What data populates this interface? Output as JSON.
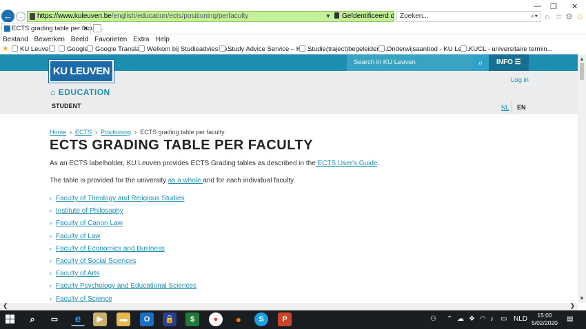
{
  "browser": {
    "url_host": "https://www.kuleuven.be",
    "url_path": "/english/education/ects/positioning/perfaculty",
    "cert_label": "Geïdentificeerd door DigiCert",
    "search_placeholder": "Zoeken...",
    "tab_title": "ECTS grading table per facult...",
    "menu": [
      "Bestand",
      "Bewerken",
      "Beeld",
      "Favorieten",
      "Extra",
      "Help"
    ],
    "favorites": [
      "KU Leuven",
      "Google",
      "Google Translate",
      "Welkom bij Studieadvies Le...",
      "Study Advice Service – KU ...",
      "Studie(traject)begeleiders i...",
      "Onderwijsaanbod - KU Leu...",
      "KUCL - universitaire termin..."
    ]
  },
  "site": {
    "logo": "KU LEUVEN",
    "search_placeholder": "Search in KU Leuven",
    "info_label": "INFO",
    "section": "EDUCATION",
    "audience": "STUDENT",
    "login": "Log in",
    "lang_nl": "NL",
    "lang_en": "EN"
  },
  "breadcrumb": {
    "home": "Home",
    "ects": "ECTS",
    "positioning": "Positioning",
    "current": "ECTS grading table per faculty"
  },
  "content": {
    "title": "ECTS GRADING TABLE PER FACULTY",
    "p1_prefix": "As an ECTS labelholder, KU Leuven provides ECTS Grading tables as described in the",
    "p1_link": " ECTS User's Guide",
    "p1_suffix": ".",
    "p2_prefix": "The table is provided for the university ",
    "p2_link": "as a whole ",
    "p2_suffix": "and for each individual faculty.",
    "faculties": [
      "Faculty of Theology and Religious Studies",
      "Institute of Philosophy",
      "Faculty of Canon Law",
      "Faculty of Law",
      "Faculty of Economics and Business",
      "Faculty of Social Sciences",
      "Faculty of Arts",
      "Faculty Psychology and Educational Sciences",
      "Faculty of Science"
    ]
  },
  "taskbar": {
    "language": "NLD",
    "time": "15:00",
    "date": "5/02/2020"
  }
}
